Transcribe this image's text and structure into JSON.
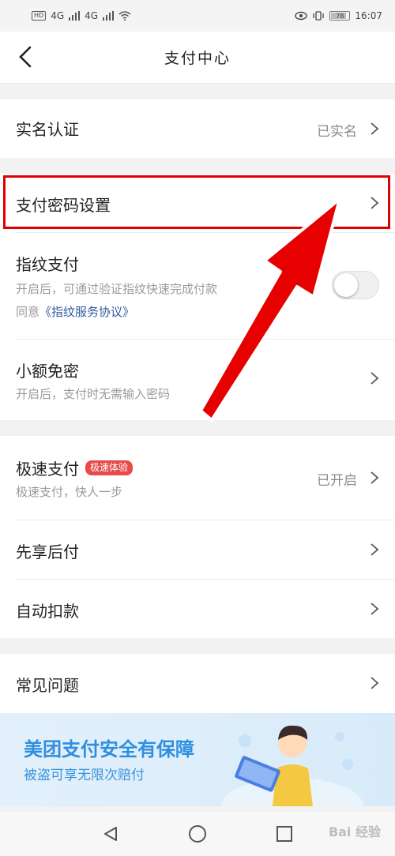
{
  "status_bar": {
    "network": "4G",
    "network2": "4G",
    "battery": "78",
    "time": "16:07"
  },
  "header": {
    "title": "支付中心"
  },
  "section1": {
    "realname": {
      "label": "实名认证",
      "value": "已实名"
    }
  },
  "section2": {
    "password": {
      "label": "支付密码设置"
    },
    "fingerprint": {
      "label": "指纹支付",
      "sub": "开启后，可通过验证指纹快速完成付款",
      "agree_prefix": "同意",
      "agree_link": "《指纹服务协议》",
      "enabled": false
    },
    "small_free": {
      "label": "小额免密",
      "sub": "开启后，支付时无需输入密码"
    }
  },
  "section3": {
    "fast_pay": {
      "label": "极速支付",
      "badge": "极速体验",
      "sub": "极速支付，快人一步",
      "value": "已开启"
    },
    "pay_later": {
      "label": "先享后付"
    },
    "auto_deduct": {
      "label": "自动扣款"
    }
  },
  "section4": {
    "faq": {
      "label": "常见问题"
    }
  },
  "banner": {
    "title": "美团支付安全有保障",
    "subtitle": "被盗可享无限次赔付"
  },
  "watermark": "Bai 经验",
  "colors": {
    "accent_red": "#e00000",
    "banner_blue": "#2e8fe0",
    "badge_red": "#e84a4a",
    "link_blue": "#2f5c9e"
  }
}
